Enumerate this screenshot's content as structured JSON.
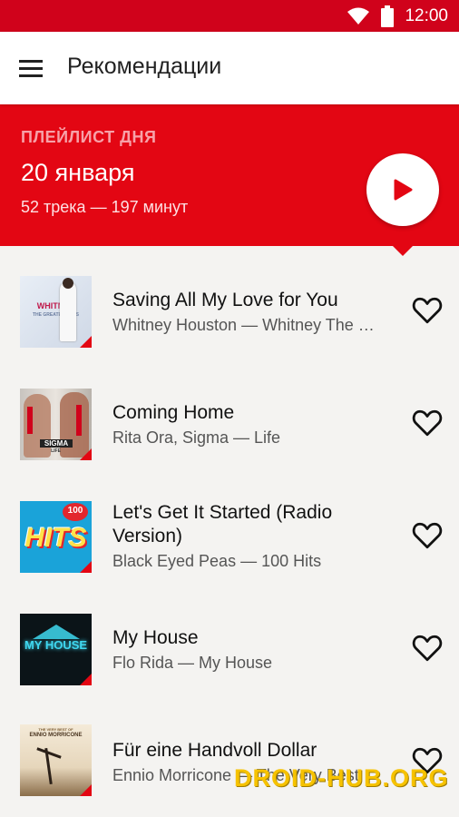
{
  "status_bar": {
    "time": "12:00",
    "wifi_icon": "wifi-icon",
    "battery_icon": "battery-icon"
  },
  "toolbar": {
    "title": "Рекомендации",
    "menu_icon": "hamburger-icon"
  },
  "hero": {
    "label": "ПЛЕЙЛИСТ ДНЯ",
    "date": "20 января",
    "meta": "52 трека — 197 минут",
    "play_icon": "play-icon"
  },
  "tracks": [
    {
      "title": "Saving All My Love for You",
      "subtitle": "Whitney Houston — Whitney The Greatest Hits",
      "cover_text": "WHITNEY",
      "cover_sub": "THE GREATEST HITS"
    },
    {
      "title": "Coming Home",
      "subtitle": "Rita Ora, Sigma — Life",
      "cover_text": "SIGMA",
      "cover_sub": "LIFE"
    },
    {
      "title": "Let's Get It Started (Radio Version)",
      "subtitle": "Black Eyed Peas — 100 Hits",
      "cover_text": "HITS",
      "cover_sub": "100"
    },
    {
      "title": "My House",
      "subtitle": "Flo Rida — My House",
      "cover_text": "MY HOUSE",
      "cover_sub": ""
    },
    {
      "title": "Für eine Handvoll Dollar",
      "subtitle": "Ennio Morricone — The Very Best",
      "cover_text": "ENNIO MORRICONE",
      "cover_sub": "THE VERY BEST OF"
    }
  ],
  "watermark": "DROID-HUB.ORG",
  "colors": {
    "accent": "#e30613",
    "status": "#d0021b",
    "background": "#f4f3f1"
  }
}
